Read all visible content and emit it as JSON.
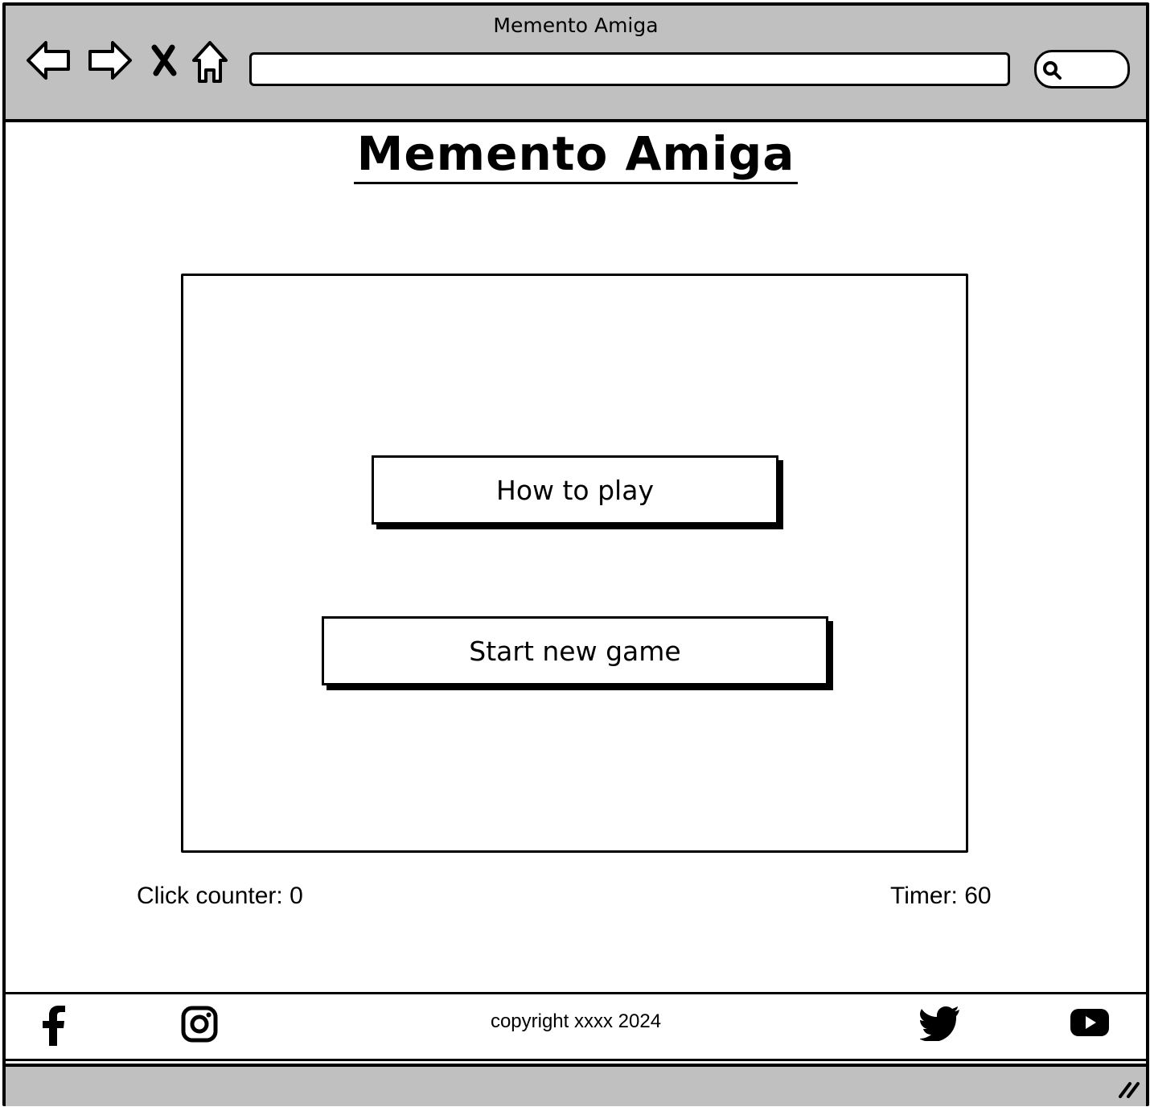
{
  "window": {
    "title": "Memento Amiga"
  },
  "toolbar": {
    "icons": [
      "back-arrow-icon",
      "forward-arrow-icon",
      "close-icon",
      "home-icon"
    ],
    "url_value": "",
    "search_icon": "search-icon"
  },
  "page": {
    "title": "Memento Amiga",
    "buttons": {
      "how_to_play": "How to play",
      "start_new_game": "Start new game"
    },
    "stats": {
      "click_counter": "Click counter: 0",
      "timer": "Timer: 60"
    }
  },
  "footer": {
    "copyright": "copyright xxxx 2024",
    "social_icons": [
      "facebook-icon",
      "instagram-icon",
      "twitter-icon",
      "youtube-icon"
    ]
  },
  "colors": {
    "chrome": "#c0c0c0",
    "ink": "#000000",
    "background": "#ffffff"
  }
}
